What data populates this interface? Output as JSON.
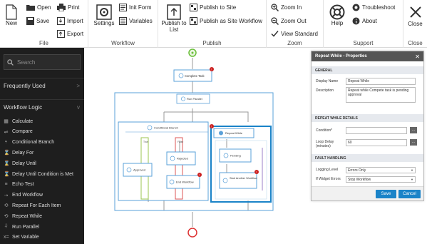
{
  "ribbon": {
    "file": {
      "group_label": "File",
      "new": "New",
      "open": "Open",
      "save": "Save",
      "print": "Print",
      "import": "Import",
      "export": "Export"
    },
    "workflow": {
      "group_label": "Workflow",
      "settings": "Settings",
      "init_form": "Init Form",
      "variables": "Variables"
    },
    "publish": {
      "group_label": "Publish",
      "publish_to_list": "Publish to List",
      "publish_to_site": "Publish to Site",
      "publish_as_site_workflow": "Publish as Site Workflow"
    },
    "zoom": {
      "group_label": "Zoom",
      "zoom_in": "Zoom In",
      "zoom_out": "Zoom Out",
      "view_standard": "View Standard"
    },
    "support": {
      "group_label": "Support",
      "help": "Help",
      "troubleshoot": "Troubleshoot",
      "about": "About"
    },
    "close": {
      "label": "Close",
      "group_label": "Close"
    }
  },
  "sidebar": {
    "search_placeholder": "Search",
    "frequently_used": "Frequently Used",
    "workflow_logic": "Workflow Logic",
    "items": [
      {
        "label": "Calculate",
        "icon": "calculator-icon",
        "glyph": "▦"
      },
      {
        "label": "Compare",
        "icon": "compare-icon",
        "glyph": "⇌"
      },
      {
        "label": "Conditional Branch",
        "icon": "branch-icon",
        "glyph": "⑂"
      },
      {
        "label": "Delay For",
        "icon": "hourglass-icon",
        "glyph": "⌛"
      },
      {
        "label": "Delay Until",
        "icon": "hourglass-icon",
        "glyph": "⌛"
      },
      {
        "label": "Delay Until Condition is Met",
        "icon": "hourglass-icon",
        "glyph": "⌛"
      },
      {
        "label": "Echo Test",
        "icon": "echo-icon",
        "glyph": "≡"
      },
      {
        "label": "End Workflow",
        "icon": "end-icon",
        "glyph": "➝"
      },
      {
        "label": "Repeat For Each Item",
        "icon": "repeat-icon",
        "glyph": "⟲"
      },
      {
        "label": "Repeat While",
        "icon": "repeat-icon",
        "glyph": "⟲"
      },
      {
        "label": "Run Parallel",
        "icon": "parallel-icon",
        "glyph": "⫩"
      },
      {
        "label": "Set Variable",
        "icon": "variable-icon",
        "glyph": "x="
      }
    ]
  },
  "canvas": {
    "complete_task": "Complete Task",
    "run_parallel": "Run Parallel",
    "conditional_branch": "Conditional Branch",
    "true_label": "True",
    "false_label": "False",
    "rejected": "Rejected",
    "approved": "Approved",
    "end_workflow": "End Workflow",
    "repeat_while": "Repeat While",
    "pending": "Pending",
    "start_another_workflow": "Start Another Workflow"
  },
  "properties": {
    "title": "Repeat While - Properties",
    "general": "GENERAL",
    "display_name_label": "Display Name",
    "display_name_value": "Repeat While",
    "description_label": "Description",
    "description_value": "Repeat while Compete task is pending approval",
    "repeat_while_details": "REPEAT WHILE DETAILS",
    "condition_label": "Condition*",
    "condition_value": "",
    "loop_delay_label": "Loop Delay (minutes)",
    "loop_delay_value": "60",
    "fault_handling": "FAULT HANDLING",
    "logging_level_label": "Logging Level",
    "logging_level_value": "Errors Only",
    "widget_errors_label": "If Widget Errors",
    "widget_errors_value": "Stop Workflow",
    "ellipsis": "...",
    "save": "Save",
    "cancel": "Cancel"
  },
  "colors": {
    "accent": "#1a83c8",
    "node_border": "#5aa0d8",
    "error_red": "#cc2222",
    "start_green": "#6bbf3b",
    "end_red": "#d33"
  }
}
